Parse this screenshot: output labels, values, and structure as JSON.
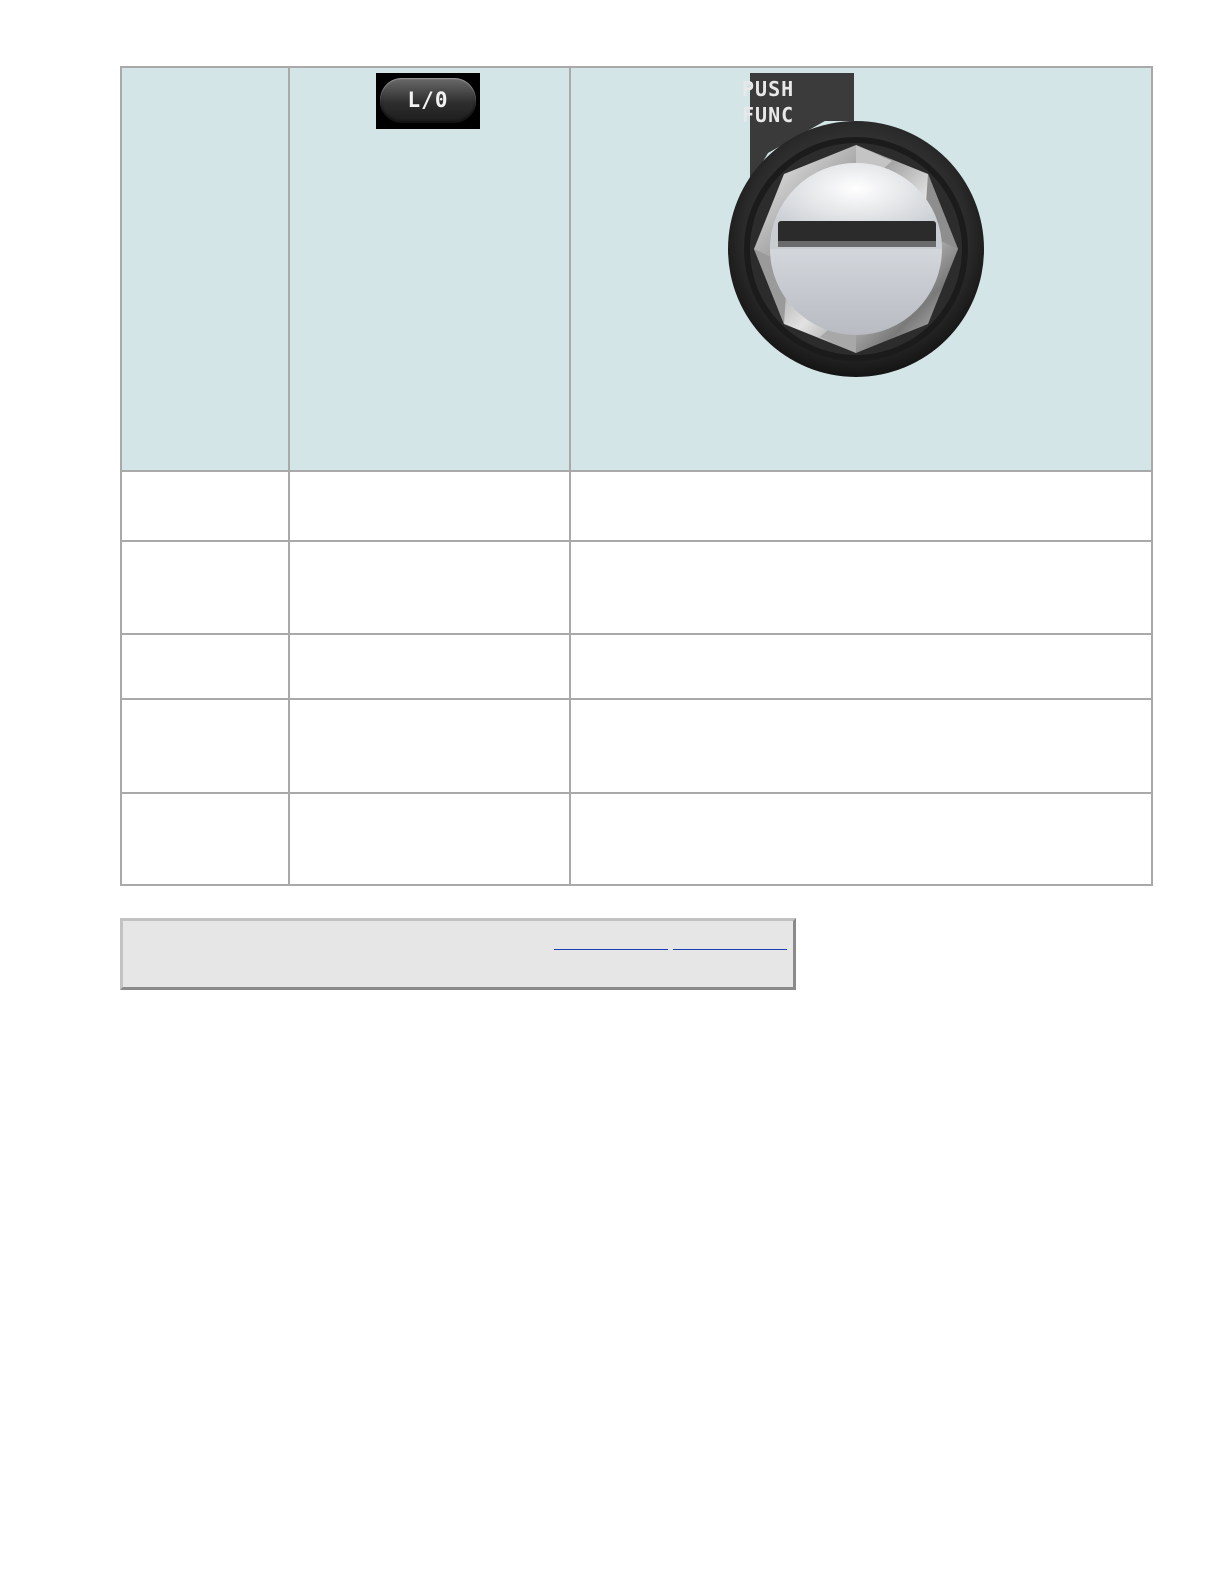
{
  "illustrations": {
    "lo_button": {
      "label": "L/0",
      "icon": "lo-button-icon"
    },
    "knob": {
      "label_line1": "PUSH",
      "label_line2": "FUNC",
      "icon": "push-func-knob-icon"
    }
  },
  "colors": {
    "header_band": "#d4e5e8",
    "grid_line": "#a9a9a9",
    "note_background": "#e6e6e6",
    "link": "#1a3fb5"
  },
  "table": {
    "rows": [
      {
        "c1": "",
        "c2": "",
        "c3": ""
      },
      {
        "c1": "",
        "c2": "",
        "c3": ""
      },
      {
        "c1": "",
        "c2": "",
        "c3": ""
      },
      {
        "c1": "",
        "c2": "",
        "c3": ""
      },
      {
        "c1": "",
        "c2": "",
        "c3": ""
      }
    ]
  },
  "note": {
    "links": [
      {
        "label": ""
      },
      {
        "label": ""
      }
    ]
  }
}
